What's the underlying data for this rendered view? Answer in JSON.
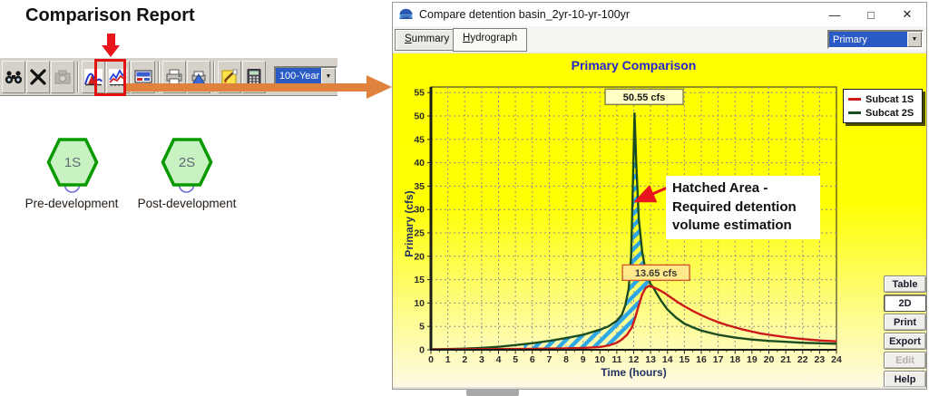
{
  "colors": {
    "accent_orange": "#e0823e",
    "highlight_red": "#e8151d",
    "hatch_blue": "#2ea8e6",
    "panel_yellow": "#ffff00",
    "title_blue": "#2424d0",
    "node_green_fill": "#c9f2c3",
    "node_green_border": "#0a9a00"
  },
  "left_panel": {
    "heading": "Comparison Report",
    "toolbar": {
      "dropdown_value": "100-Year",
      "icons": [
        "binoculars",
        "delete-x",
        "snapshot-disabled",
        "area-chart",
        "comparison-report",
        "screen-report",
        "print",
        "print-preview",
        "notes",
        "calculator"
      ]
    },
    "nodes": [
      {
        "id": "1S",
        "label": "Pre-development"
      },
      {
        "id": "2S",
        "label": "Post-development"
      }
    ]
  },
  "window": {
    "title": "Compare detention basin_2yr-10-yr-100yr",
    "controls": {
      "minimize": "—",
      "maximize": "□",
      "close": "✕"
    },
    "tabs": [
      {
        "accel": "S",
        "rest": "ummary"
      },
      {
        "accel": "H",
        "rest": "ydrograph"
      }
    ],
    "active_tab": "Hydrograph",
    "view_dropdown_value": "Primary",
    "side_buttons": [
      {
        "label": "Table",
        "state": "normal"
      },
      {
        "label": "2D",
        "state": "pressed"
      },
      {
        "label": "Print",
        "state": "normal"
      },
      {
        "label": "Export",
        "state": "normal"
      },
      {
        "label": "Edit",
        "state": "disabled"
      },
      {
        "label": "Help",
        "state": "normal"
      }
    ]
  },
  "chart_data": {
    "type": "line",
    "title": "Primary Comparison",
    "xlabel": "Time (hours)",
    "ylabel": "Primary (cfs)",
    "xlim": [
      0,
      24
    ],
    "ylim": [
      0,
      55
    ],
    "x_ticks": [
      0,
      1,
      2,
      3,
      4,
      5,
      6,
      7,
      8,
      9,
      10,
      11,
      12,
      13,
      14,
      15,
      16,
      17,
      18,
      19,
      20,
      21,
      22,
      23,
      24
    ],
    "y_ticks": [
      0,
      5,
      10,
      15,
      20,
      25,
      30,
      35,
      40,
      45,
      50,
      55
    ],
    "grid": true,
    "legend_position": "top-right",
    "series": [
      {
        "name": "Subcat 1S",
        "color": "#cc1a1a",
        "peak_label": "13.65 cfs",
        "peak": [
          12.9,
          13.65
        ],
        "label_pos": [
          13.32,
          16.4
        ],
        "points": [
          [
            0,
            0.05
          ],
          [
            2,
            0.1
          ],
          [
            4,
            0.15
          ],
          [
            6,
            0.2
          ],
          [
            7,
            0.25
          ],
          [
            8,
            0.3
          ],
          [
            9,
            0.4
          ],
          [
            10,
            0.6
          ],
          [
            10.5,
            0.9
          ],
          [
            11,
            1.5
          ],
          [
            11.3,
            2.2
          ],
          [
            11.6,
            3.2
          ],
          [
            11.9,
            4.8
          ],
          [
            12.1,
            7.0
          ],
          [
            12.3,
            9.5
          ],
          [
            12.5,
            11.8
          ],
          [
            12.7,
            13.2
          ],
          [
            12.9,
            13.65
          ],
          [
            13.15,
            13.4
          ],
          [
            13.4,
            13.0
          ],
          [
            13.8,
            12.2
          ],
          [
            14.2,
            11.2
          ],
          [
            14.6,
            10.2
          ],
          [
            15,
            9.3
          ],
          [
            15.5,
            8.3
          ],
          [
            16,
            7.4
          ],
          [
            16.5,
            6.6
          ],
          [
            17,
            5.9
          ],
          [
            17.5,
            5.3
          ],
          [
            18,
            4.8
          ],
          [
            18.5,
            4.3
          ],
          [
            19,
            3.9
          ],
          [
            19.5,
            3.5
          ],
          [
            20,
            3.2
          ],
          [
            21,
            2.7
          ],
          [
            22,
            2.3
          ],
          [
            23,
            2.0
          ],
          [
            24,
            1.8
          ]
        ]
      },
      {
        "name": "Subcat 2S",
        "color": "#1c4d21",
        "peak_label": "50.55 cfs",
        "peak": [
          12.05,
          50.55
        ],
        "label_pos": [
          12.62,
          54.0
        ],
        "points": [
          [
            0,
            0.1
          ],
          [
            1,
            0.15
          ],
          [
            2,
            0.25
          ],
          [
            3,
            0.4
          ],
          [
            4,
            0.65
          ],
          [
            5,
            1.0
          ],
          [
            5.5,
            1.2
          ],
          [
            6,
            1.4
          ],
          [
            7,
            1.9
          ],
          [
            8,
            2.5
          ],
          [
            9,
            3.2
          ],
          [
            10,
            4.3
          ],
          [
            10.5,
            5.0
          ],
          [
            11,
            6.2
          ],
          [
            11.3,
            7.5
          ],
          [
            11.5,
            9.5
          ],
          [
            11.7,
            13.0
          ],
          [
            11.85,
            20.0
          ],
          [
            11.95,
            35.0
          ],
          [
            12.05,
            50.55
          ],
          [
            12.15,
            40.0
          ],
          [
            12.3,
            28.0
          ],
          [
            12.5,
            21.0
          ],
          [
            12.7,
            17.0
          ],
          [
            13,
            14.0
          ],
          [
            13.15,
            13.4
          ],
          [
            13.3,
            12.4
          ],
          [
            13.6,
            10.6
          ],
          [
            14,
            8.6
          ],
          [
            14.5,
            6.9
          ],
          [
            15,
            5.6
          ],
          [
            15.5,
            4.8
          ],
          [
            16,
            4.1
          ],
          [
            17,
            3.2
          ],
          [
            18,
            2.6
          ],
          [
            19,
            2.2
          ],
          [
            20,
            1.9
          ],
          [
            21,
            1.7
          ],
          [
            22,
            1.5
          ],
          [
            23,
            1.4
          ],
          [
            24,
            1.3
          ]
        ]
      }
    ],
    "hatch_region": [
      [
        5.5,
        1.2
      ],
      [
        6,
        1.4
      ],
      [
        7,
        1.9
      ],
      [
        8,
        2.5
      ],
      [
        9,
        3.2
      ],
      [
        10,
        4.3
      ],
      [
        10.5,
        5.0
      ],
      [
        11,
        6.2
      ],
      [
        11.3,
        7.5
      ],
      [
        11.5,
        9.5
      ],
      [
        11.7,
        13.0
      ],
      [
        11.85,
        20.0
      ],
      [
        11.95,
        35.0
      ],
      [
        12.05,
        50.55
      ],
      [
        12.15,
        40.0
      ],
      [
        12.3,
        28.0
      ],
      [
        12.5,
        21.0
      ],
      [
        12.7,
        17.0
      ],
      [
        13,
        14.0
      ],
      [
        13.15,
        13.4
      ],
      [
        12.9,
        13.65
      ],
      [
        12.7,
        13.2
      ],
      [
        12.5,
        11.8
      ],
      [
        12.3,
        9.5
      ],
      [
        12.1,
        7.0
      ],
      [
        11.9,
        4.8
      ],
      [
        11.6,
        3.2
      ],
      [
        11.3,
        2.2
      ],
      [
        11,
        1.5
      ],
      [
        10.5,
        0.9
      ],
      [
        10,
        0.6
      ],
      [
        9,
        0.4
      ],
      [
        8,
        0.3
      ],
      [
        7,
        0.25
      ],
      [
        6,
        0.2
      ],
      [
        5.5,
        0.18
      ]
    ],
    "annotation": "Hatched Area -\nRequired detention\nvolume estimation"
  }
}
